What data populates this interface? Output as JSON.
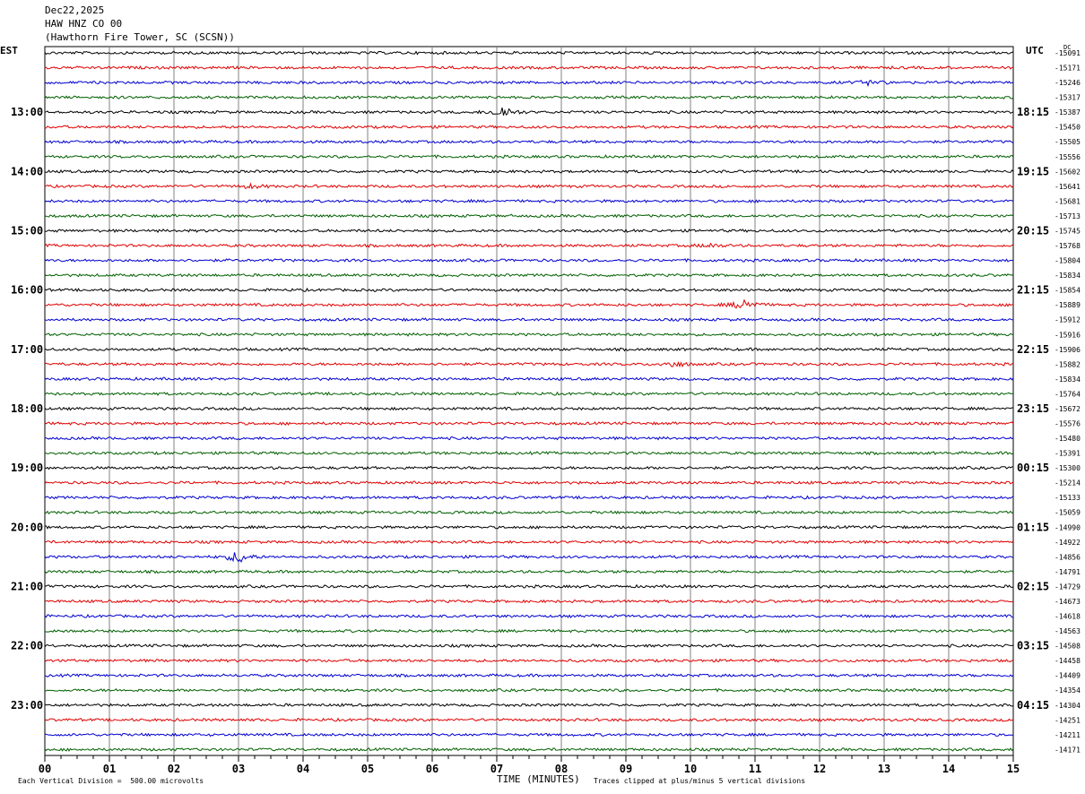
{
  "header": {
    "date": "Dec22,2025",
    "channel": "HAW HNZ CO 00",
    "station": "(Hawthorn Fire Tower, SC (SCSN))"
  },
  "left_tz": "EST",
  "right_tz": "UTC",
  "dc_label": "DC",
  "footer": {
    "scale_note": "Each Vertical Division =  500.00 microvolts",
    "xlabel": "TIME (MINUTES)",
    "clip_note": "Traces clipped at plus/minus 5 vertical divisions"
  },
  "colors": {
    "cycle": [
      "#000000",
      "#e00000",
      "#0000d0",
      "#006000"
    ],
    "grid": "#808080"
  },
  "chart_data": {
    "type": "line",
    "title": "HAW HNZ CO 00",
    "xlabel": "TIME (MINUTES)",
    "xlim": [
      0,
      15
    ],
    "x_ticks": [
      "00",
      "01",
      "02",
      "03",
      "04",
      "05",
      "06",
      "07",
      "08",
      "09",
      "10",
      "11",
      "12",
      "13",
      "14",
      "15"
    ],
    "rows_per_hour": 4,
    "row_count": 48,
    "left_hour_labels": [
      "13:00",
      "14:00",
      "15:00",
      "16:00",
      "17:00",
      "18:00",
      "19:00",
      "20:00",
      "21:00",
      "22:00",
      "23:00"
    ],
    "right_hour_labels": [
      "18:15",
      "19:15",
      "20:15",
      "21:15",
      "22:15",
      "23:15",
      "00:15",
      "01:15",
      "02:15",
      "03:15",
      "04:15"
    ],
    "dc_offsets": [
      -15091,
      -15171,
      -15246,
      -15317,
      -15387,
      -15450,
      -15505,
      -15556,
      -15602,
      -15641,
      -15681,
      -15713,
      -15745,
      -15768,
      -15804,
      -15834,
      -15854,
      -15889,
      -15912,
      -15916,
      -15906,
      -15882,
      -15834,
      -15764,
      -15672,
      -15576,
      -15480,
      -15391,
      -15300,
      -15214,
      -15133,
      -15059,
      -14990,
      -14922,
      -14856,
      -14791,
      -14729,
      -14673,
      -14618,
      -14563,
      -14508,
      -14458,
      -14409,
      -14354,
      -14304,
      -14251,
      -14211,
      -14171
    ],
    "events": [
      {
        "row": 4,
        "minute": 7.1,
        "amp": 1.0
      },
      {
        "row": 17,
        "minute": 10.85,
        "amp": 1.0
      },
      {
        "row": 21,
        "minute": 9.75,
        "amp": 0.5
      },
      {
        "row": 34,
        "minute": 3.0,
        "amp": 1.0
      },
      {
        "row": 13,
        "minute": 10.3,
        "amp": 0.3
      },
      {
        "row": 2,
        "minute": 12.8,
        "amp": 0.4
      },
      {
        "row": 9,
        "minute": 3.2,
        "amp": 0.3
      }
    ]
  }
}
